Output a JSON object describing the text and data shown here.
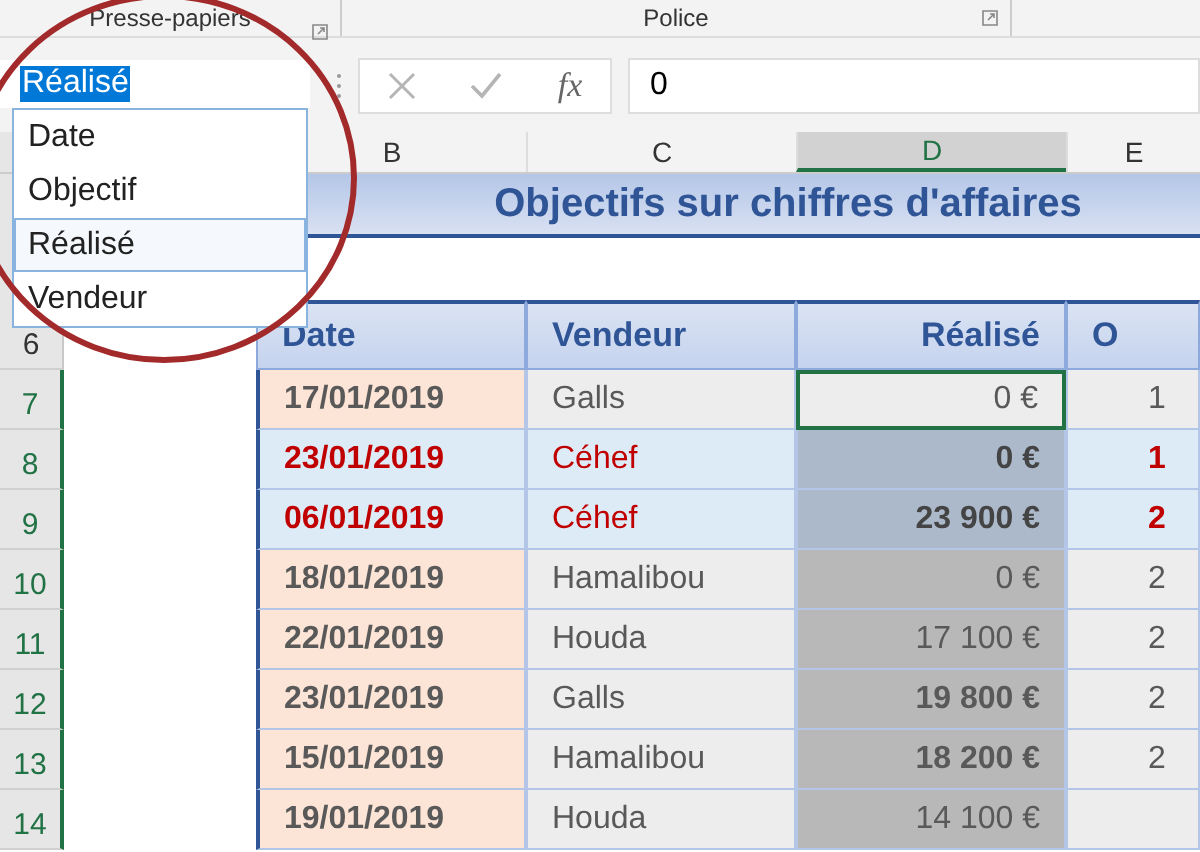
{
  "ribbon": {
    "groups": [
      {
        "label": "Presse-papiers"
      },
      {
        "label": "Police"
      }
    ]
  },
  "name_box": {
    "value": "Réalisé"
  },
  "name_list": [
    {
      "label": "Date",
      "selected": false
    },
    {
      "label": "Objectif",
      "selected": false
    },
    {
      "label": "Réalisé",
      "selected": true
    },
    {
      "label": "Vendeur",
      "selected": false
    }
  ],
  "formula_bar": {
    "fx_label": "fx",
    "value": "0"
  },
  "column_letters": [
    {
      "letter": "B",
      "selected": false
    },
    {
      "letter": "C",
      "selected": false
    },
    {
      "letter": "D",
      "selected": true
    },
    {
      "letter": "E",
      "selected": false
    }
  ],
  "title": "Objectifs sur chiffres d'affaires",
  "table": {
    "header_row": "6",
    "columns": [
      "Date",
      "Vendeur",
      "Réalisé",
      "O"
    ],
    "rows": [
      {
        "row": "7",
        "date": "17/01/2019",
        "vendeur": "Galls",
        "realise": "0 €",
        "column_4": "1",
        "flagged": false,
        "shaded": false,
        "bold": false,
        "active": true
      },
      {
        "row": "8",
        "date": "23/01/2019",
        "vendeur": "Céhef",
        "realise": "0 €",
        "column_4": "1",
        "flagged": true,
        "shaded": true,
        "bold": true,
        "active": false
      },
      {
        "row": "9",
        "date": "06/01/2019",
        "vendeur": "Céhef",
        "realise": "23 900 €",
        "column_4": "2",
        "flagged": true,
        "shaded": true,
        "bold": true,
        "active": false
      },
      {
        "row": "10",
        "date": "18/01/2019",
        "vendeur": "Hamalibou",
        "realise": "0 €",
        "column_4": "2",
        "flagged": false,
        "shaded": true,
        "bold": false,
        "active": false
      },
      {
        "row": "11",
        "date": "22/01/2019",
        "vendeur": "Houda",
        "realise": "17 100 €",
        "column_4": "2",
        "flagged": false,
        "shaded": true,
        "bold": false,
        "active": false
      },
      {
        "row": "12",
        "date": "23/01/2019",
        "vendeur": "Galls",
        "realise": "19 800 €",
        "column_4": "2",
        "flagged": false,
        "shaded": true,
        "bold": true,
        "active": false
      },
      {
        "row": "13",
        "date": "15/01/2019",
        "vendeur": "Hamalibou",
        "realise": "18 200 €",
        "column_4": "2",
        "flagged": false,
        "shaded": true,
        "bold": true,
        "active": false
      },
      {
        "row": "14",
        "date": "19/01/2019",
        "vendeur": "Houda",
        "realise": "14 100 €",
        "flagged": false,
        "shaded": true,
        "bold": false,
        "active": false
      }
    ]
  }
}
